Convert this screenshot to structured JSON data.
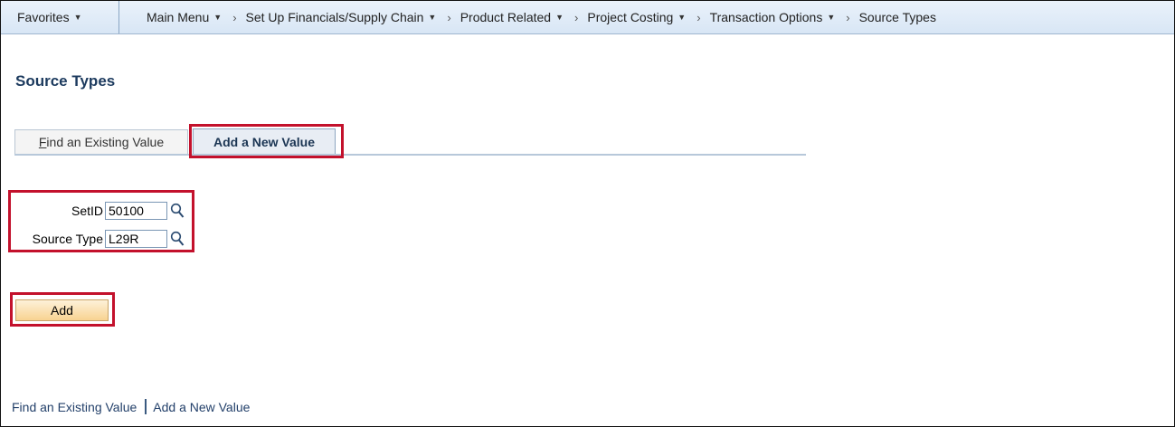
{
  "navbar": {
    "favorites": "Favorites",
    "breadcrumb": [
      {
        "label": "Main Menu",
        "has_menu": true
      },
      {
        "label": "Set Up Financials/Supply Chain",
        "has_menu": true
      },
      {
        "label": "Product Related",
        "has_menu": true
      },
      {
        "label": "Project Costing",
        "has_menu": true
      },
      {
        "label": "Transaction Options",
        "has_menu": true
      },
      {
        "label": "Source Types",
        "has_menu": false
      }
    ]
  },
  "page": {
    "title": "Source Types"
  },
  "tabs": {
    "find_hotkey": "F",
    "find_rest": "ind an Existing Value",
    "add": "Add a New Value"
  },
  "form": {
    "setid_label": "SetID",
    "setid_value": "50100",
    "source_type_label": "Source Type",
    "source_type_value": "L29R"
  },
  "buttons": {
    "add": "Add"
  },
  "footer": {
    "find_link": "Find an Existing Value",
    "add_link": "Add a New Value"
  },
  "colors": {
    "highlight": "#c3112c",
    "title": "#1c3a5e",
    "add_button": "#f8d391"
  },
  "icons": [
    "chevron-down-icon",
    "chevron-right-icon",
    "lookup-icon"
  ]
}
